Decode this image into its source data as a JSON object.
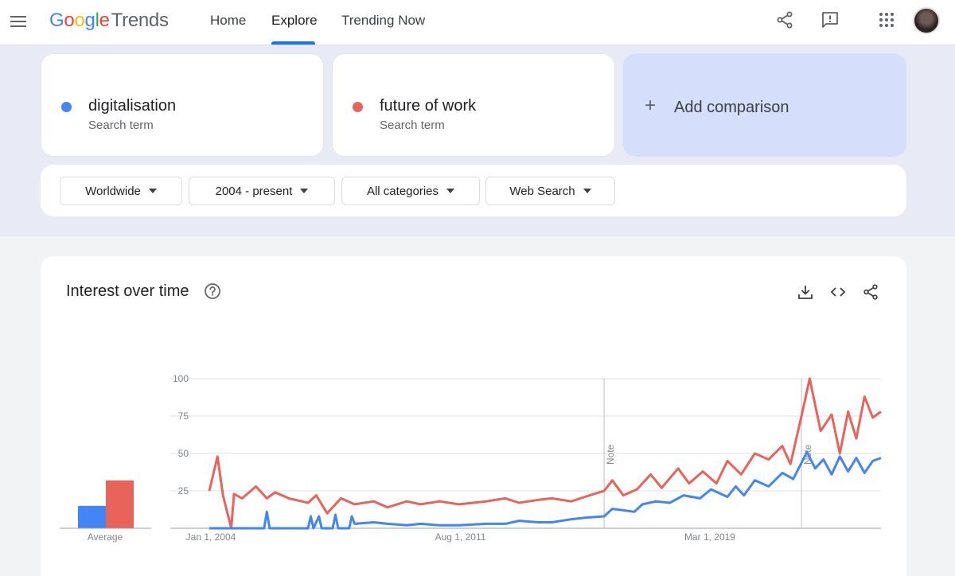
{
  "header": {
    "logo_google": "Google",
    "logo_product": "Trends",
    "nav": [
      "Home",
      "Explore",
      "Trending Now"
    ],
    "active_nav": "Explore"
  },
  "terms": [
    {
      "name": "digitalisation",
      "sub": "Search term",
      "color": "#4285f4"
    },
    {
      "name": "future of work",
      "sub": "Search term",
      "color": "#e8635a"
    }
  ],
  "add_comparison": {
    "icon": "plus-icon",
    "label": "Add comparison"
  },
  "filters": [
    "Worldwide",
    "2004 - present",
    "All categories",
    "Web Search"
  ],
  "chart": {
    "title": "Interest over time",
    "average_label": "Average",
    "note_label": "Note"
  },
  "chart_data": {
    "type": "line",
    "title": "Interest over time",
    "x_tick_labels": [
      "Jan 1, 2004",
      "Aug 1, 2011",
      "Mar 1, 2019"
    ],
    "x_range": [
      "2004-01",
      "2024-06"
    ],
    "ylim": [
      0,
      100
    ],
    "y_ticks": [
      25,
      50,
      75,
      100
    ],
    "grid": true,
    "notes_at": [
      "2016-01",
      "2022-01"
    ],
    "average": [
      {
        "name": "digitalisation",
        "value": 15,
        "color": "#4285f4"
      },
      {
        "name": "future of work",
        "value": 32,
        "color": "#e8635a"
      }
    ],
    "series": [
      {
        "name": "digitalisation",
        "color": "#4285f4",
        "points": [
          [
            "2004-01",
            0
          ],
          [
            "2005-01",
            0
          ],
          [
            "2005-09",
            0
          ],
          [
            "2005-10",
            11
          ],
          [
            "2005-11",
            0
          ],
          [
            "2006-06",
            0
          ],
          [
            "2007-01",
            0
          ],
          [
            "2007-02",
            8
          ],
          [
            "2007-03",
            0
          ],
          [
            "2007-05",
            8
          ],
          [
            "2007-06",
            0
          ],
          [
            "2007-10",
            0
          ],
          [
            "2007-11",
            9
          ],
          [
            "2007-12",
            0
          ],
          [
            "2008-04",
            0
          ],
          [
            "2008-05",
            8
          ],
          [
            "2008-06",
            3
          ],
          [
            "2009-01",
            4
          ],
          [
            "2009-06",
            3
          ],
          [
            "2010-01",
            2
          ],
          [
            "2010-06",
            3
          ],
          [
            "2011-01",
            2
          ],
          [
            "2011-08",
            2
          ],
          [
            "2012-06",
            3
          ],
          [
            "2013-01",
            3
          ],
          [
            "2013-06",
            5
          ],
          [
            "2014-01",
            4
          ],
          [
            "2014-06",
            4
          ],
          [
            "2015-01",
            6
          ],
          [
            "2015-06",
            7
          ],
          [
            "2016-01",
            8
          ],
          [
            "2016-04",
            13
          ],
          [
            "2016-08",
            12
          ],
          [
            "2016-12",
            11
          ],
          [
            "2017-03",
            16
          ],
          [
            "2017-08",
            18
          ],
          [
            "2018-01",
            17
          ],
          [
            "2018-06",
            22
          ],
          [
            "2018-12",
            20
          ],
          [
            "2019-04",
            26
          ],
          [
            "2019-10",
            21
          ],
          [
            "2020-01",
            28
          ],
          [
            "2020-04",
            22
          ],
          [
            "2020-08",
            32
          ],
          [
            "2021-01",
            28
          ],
          [
            "2021-06",
            37
          ],
          [
            "2021-10",
            33
          ],
          [
            "2022-03",
            51
          ],
          [
            "2022-06",
            40
          ],
          [
            "2022-09",
            46
          ],
          [
            "2022-12",
            36
          ],
          [
            "2023-03",
            48
          ],
          [
            "2023-06",
            38
          ],
          [
            "2023-09",
            47
          ],
          [
            "2023-12",
            37
          ],
          [
            "2024-03",
            45
          ],
          [
            "2024-06",
            47
          ]
        ]
      },
      {
        "name": "future of work",
        "color": "#e8635a",
        "points": [
          [
            "2004-01",
            25
          ],
          [
            "2004-04",
            48
          ],
          [
            "2004-06",
            22
          ],
          [
            "2004-09",
            0
          ],
          [
            "2004-10",
            23
          ],
          [
            "2005-01",
            20
          ],
          [
            "2005-06",
            28
          ],
          [
            "2005-10",
            20
          ],
          [
            "2006-01",
            24
          ],
          [
            "2006-06",
            20
          ],
          [
            "2007-01",
            17
          ],
          [
            "2007-04",
            22
          ],
          [
            "2007-08",
            10
          ],
          [
            "2008-01",
            20
          ],
          [
            "2008-06",
            16
          ],
          [
            "2009-01",
            18
          ],
          [
            "2009-06",
            14
          ],
          [
            "2010-01",
            18
          ],
          [
            "2010-06",
            16
          ],
          [
            "2011-01",
            18
          ],
          [
            "2011-08",
            16
          ],
          [
            "2012-06",
            18
          ],
          [
            "2013-01",
            20
          ],
          [
            "2013-06",
            17
          ],
          [
            "2014-01",
            19
          ],
          [
            "2014-06",
            20
          ],
          [
            "2015-01",
            18
          ],
          [
            "2015-06",
            21
          ],
          [
            "2016-01",
            25
          ],
          [
            "2016-04",
            32
          ],
          [
            "2016-08",
            22
          ],
          [
            "2017-01",
            26
          ],
          [
            "2017-06",
            36
          ],
          [
            "2017-10",
            27
          ],
          [
            "2018-04",
            40
          ],
          [
            "2018-08",
            30
          ],
          [
            "2019-01",
            38
          ],
          [
            "2019-06",
            30
          ],
          [
            "2019-10",
            45
          ],
          [
            "2020-03",
            36
          ],
          [
            "2020-08",
            50
          ],
          [
            "2021-01",
            46
          ],
          [
            "2021-06",
            55
          ],
          [
            "2021-09",
            43
          ],
          [
            "2022-01",
            75
          ],
          [
            "2022-04",
            100
          ],
          [
            "2022-08",
            65
          ],
          [
            "2022-12",
            76
          ],
          [
            "2023-03",
            50
          ],
          [
            "2023-06",
            78
          ],
          [
            "2023-09",
            60
          ],
          [
            "2023-12",
            88
          ],
          [
            "2024-03",
            74
          ],
          [
            "2024-06",
            78
          ]
        ]
      }
    ]
  }
}
